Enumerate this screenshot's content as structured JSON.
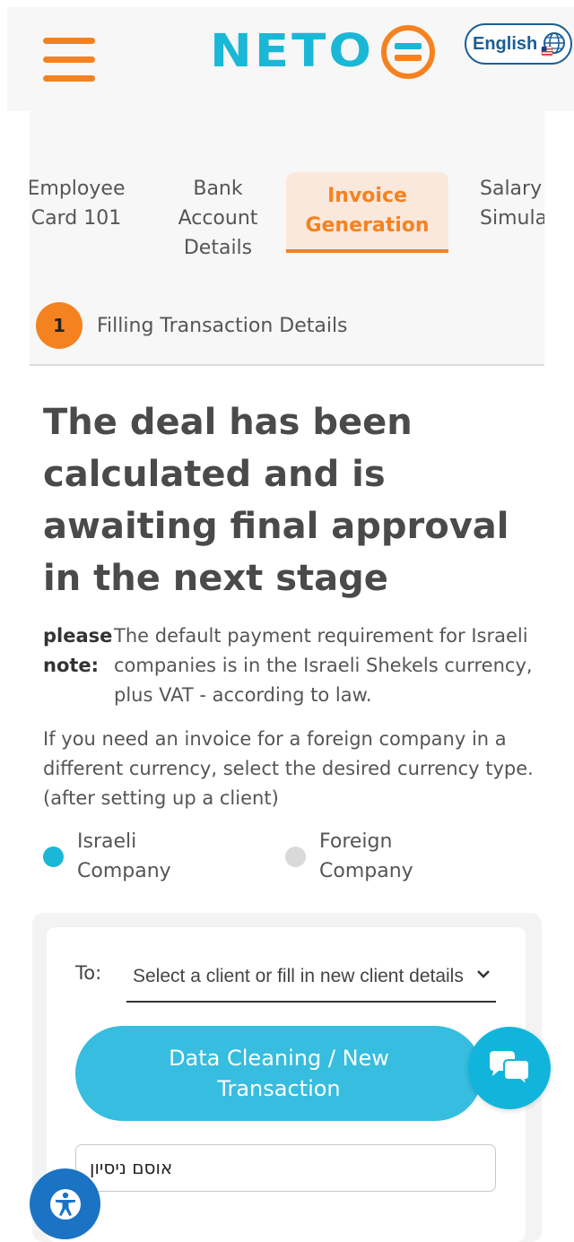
{
  "header": {
    "logo_text": "NETO",
    "language": "English"
  },
  "tabs": [
    {
      "line1": "Employee",
      "line2": "Card 101",
      "line3": ""
    },
    {
      "line1": "Bank",
      "line2": "Account",
      "line3": "Details"
    },
    {
      "line1": "Invoice",
      "line2": "Generation",
      "line3": "",
      "active": true
    },
    {
      "line1": "Salary",
      "line2": "Simulat",
      "line3": ""
    }
  ],
  "step": {
    "number": "1",
    "label": "Filling Transaction Details"
  },
  "headline": "The deal has been calculated and is awaiting final approval in the next stage",
  "note": {
    "label_line1": "please",
    "label_line2": "note:",
    "text": "The default payment requirement for Israeli companies is in the Israeli Shekels currency, plus VAT - according to law."
  },
  "foreign_text": "If you need an invoice for a foreign company in a different currency, select the desired currency type. (after setting up a client)",
  "company_type": {
    "options": [
      {
        "label_line1": "Israeli",
        "label_line2": "Company",
        "selected": true
      },
      {
        "label_line1": "Foreign",
        "label_line2": "Company",
        "selected": false
      }
    ]
  },
  "form": {
    "to_label": "To:",
    "client_placeholder": "Select a client or fill in new client details",
    "primary_button": "Data Cleaning / New Transaction",
    "name_value": "אוסם ניסיון"
  },
  "colors": {
    "brand_orange": "#f58220",
    "brand_cyan": "#1ab7d6",
    "button_cyan": "#36bde0",
    "a11y_blue": "#1a73c4"
  }
}
